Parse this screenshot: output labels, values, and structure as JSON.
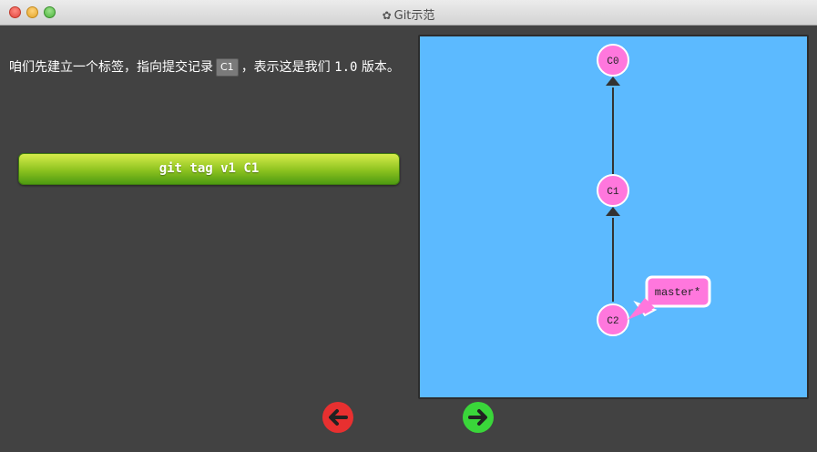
{
  "window": {
    "title": "Git示范",
    "icon": "gear-icon"
  },
  "instructions": {
    "before": "咱们先建立一个标签，指向提交记录",
    "commit": "C1",
    "middle": "，表示这是我们 ",
    "version": "1.0",
    "after": " 版本。"
  },
  "command": {
    "label": "git tag v1 C1"
  },
  "graph": {
    "commits": [
      {
        "id": "C0"
      },
      {
        "id": "C1"
      },
      {
        "id": "C2"
      }
    ],
    "branch": {
      "label": "master*",
      "points_to": "C2"
    },
    "colors": {
      "background": "#5cbaff",
      "commit": "#ff77dd",
      "label": "#ff77dd",
      "edge": "#333333"
    }
  },
  "nav": {
    "prev_icon": "arrow-left-icon",
    "next_icon": "arrow-right-icon",
    "prev_color": "#e83030",
    "next_color": "#3ad63a"
  }
}
